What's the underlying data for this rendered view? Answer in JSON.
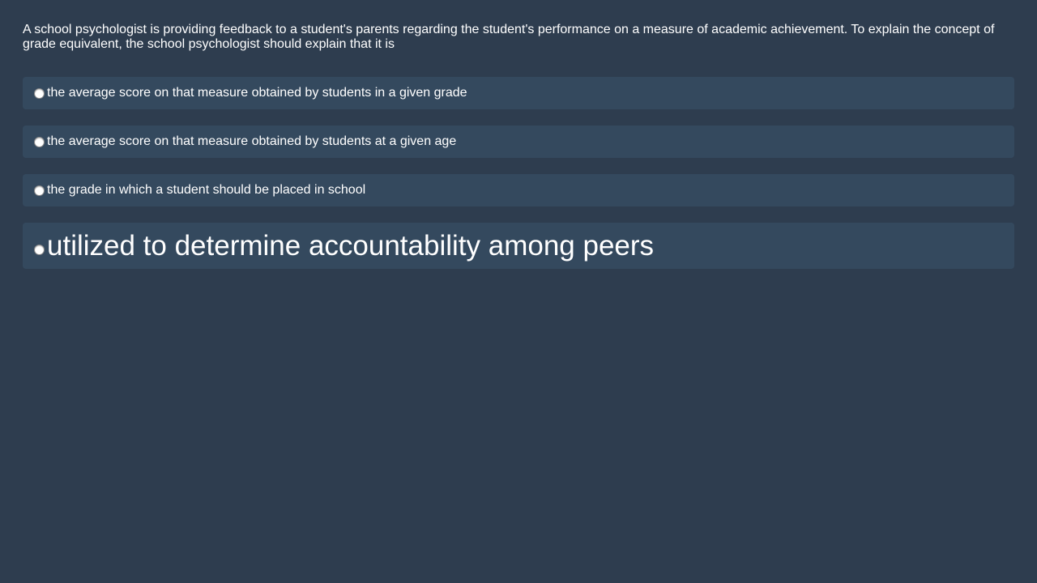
{
  "question": {
    "text": "A school psychologist is providing feedback to a student's parents regarding the student's performance on a measure of academic achievement. To explain the concept of grade equivalent, the school psychologist should explain that it is"
  },
  "options": [
    {
      "label": "the average score on that measure obtained by students in a given grade",
      "selected": false
    },
    {
      "label": "the average score on that measure obtained by students at a given age",
      "selected": false
    },
    {
      "label": "the grade in which a student should be placed in school",
      "selected": false
    },
    {
      "label": "utilized to determine accountability among peers",
      "selected": false
    }
  ],
  "colors": {
    "background": "#2e3d4f",
    "option_background": "#34495e",
    "text": "#ffffff"
  }
}
